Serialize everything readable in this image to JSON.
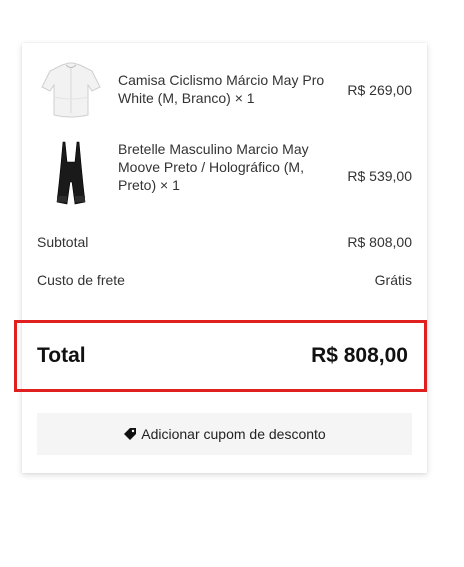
{
  "cart": {
    "items": [
      {
        "name": "Camisa Ciclismo Márcio May Pro White (M, Branco) × 1",
        "price": "R$ 269,00",
        "image": "white-cycling-jersey"
      },
      {
        "name": "Bretelle Masculino Marcio May Moove Preto / Holográfico (M, Preto) × 1",
        "price": "R$ 539,00",
        "image": "black-bib-shorts"
      }
    ],
    "subtotal_label": "Subtotal",
    "subtotal_value": "R$ 808,00",
    "shipping_label": "Custo de frete",
    "shipping_value": "Grátis",
    "total_label": "Total",
    "total_value": "R$ 808,00",
    "coupon_label": "Adicionar cupom de desconto",
    "coupon_icon": "tag-icon"
  },
  "colors": {
    "highlight": "#e0201e",
    "button_bg": "#f5f5f5"
  }
}
